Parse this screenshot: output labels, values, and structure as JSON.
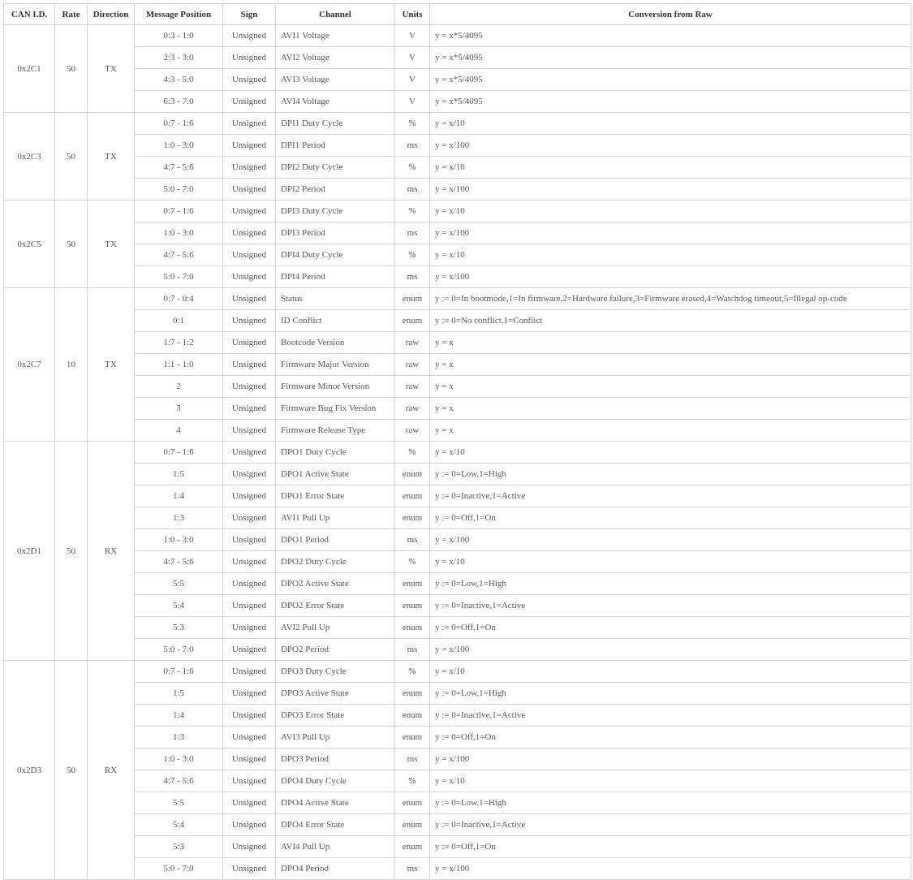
{
  "headers": [
    "CAN I.D.",
    "Rate",
    "Direction",
    "Message Position",
    "Sign",
    "Channel",
    "Units",
    "Conversion from Raw"
  ],
  "groups": [
    {
      "can_id": "0x2C1",
      "rate": "50",
      "direction": "TX",
      "rows": [
        {
          "position": "0:3 - 1:0",
          "sign": "Unsigned",
          "channel": "AVI1 Voltage",
          "units": "V",
          "conversion": "y = x*5/4095"
        },
        {
          "position": "2:3 - 3:0",
          "sign": "Unsigned",
          "channel": "AVI2 Voltage",
          "units": "V",
          "conversion": "y = x*5/4095"
        },
        {
          "position": "4:3 - 5:0",
          "sign": "Unsigned",
          "channel": "AVI3 Voltage",
          "units": "V",
          "conversion": "y = x*5/4095"
        },
        {
          "position": "6:3 - 7:0",
          "sign": "Unsigned",
          "channel": "AVI4 Voltage",
          "units": "V",
          "conversion": "y = x*5/4095"
        }
      ]
    },
    {
      "can_id": "0x2C3",
      "rate": "50",
      "direction": "TX",
      "rows": [
        {
          "position": "0:7 - 1:6",
          "sign": "Unsigned",
          "channel": "DPI1 Duty Cycle",
          "units": "%",
          "conversion": "y = x/10"
        },
        {
          "position": "1:0 - 3:0",
          "sign": "Unsigned",
          "channel": "DPI1 Period",
          "units": "ms",
          "conversion": "y = x/100"
        },
        {
          "position": "4:7 - 5:6",
          "sign": "Unsigned",
          "channel": "DPI2 Duty Cycle",
          "units": "%",
          "conversion": "y = x/10"
        },
        {
          "position": "5:0 - 7:0",
          "sign": "Unsigned",
          "channel": "DPI2 Period",
          "units": "ms",
          "conversion": "y = x/100"
        }
      ]
    },
    {
      "can_id": "0x2C5",
      "rate": "50",
      "direction": "TX",
      "rows": [
        {
          "position": "0:7 - 1:6",
          "sign": "Unsigned",
          "channel": "DPI3 Duty Cycle",
          "units": "%",
          "conversion": "y = x/10"
        },
        {
          "position": "1:0 - 3:0",
          "sign": "Unsigned",
          "channel": "DPI3 Period",
          "units": "ms",
          "conversion": "y = x/100"
        },
        {
          "position": "4:7 - 5:6",
          "sign": "Unsigned",
          "channel": "DPI4 Duty Cycle",
          "units": "%",
          "conversion": "y = x/10"
        },
        {
          "position": "5:0 - 7:0",
          "sign": "Unsigned",
          "channel": "DPI4 Period",
          "units": "ms",
          "conversion": "y = x/100"
        }
      ]
    },
    {
      "can_id": "0x2C7",
      "rate": "10",
      "direction": "TX",
      "rows": [
        {
          "position": "0:7 - 0:4",
          "sign": "Unsigned",
          "channel": "Status",
          "units": "enum",
          "conversion": "y := 0=In bootmode,1=In firmware,2=Hardware failure,3=Firmware erased,4=Watchdog timeout,5=Illegal op-code"
        },
        {
          "position": "0:1",
          "sign": "Unsigned",
          "channel": "ID Conflict",
          "units": "enum",
          "conversion": "y := 0=No conflict,1=Conflict"
        },
        {
          "position": "1:7 - 1:2",
          "sign": "Unsigned",
          "channel": "Bootcode Version",
          "units": "raw",
          "conversion": "y = x"
        },
        {
          "position": "1:1 - 1:0",
          "sign": "Unsigned",
          "channel": "Firmware Major Version",
          "units": "raw",
          "conversion": "y = x"
        },
        {
          "position": "2",
          "sign": "Unsigned",
          "channel": "Firmware Minor Version",
          "units": "raw",
          "conversion": "y = x"
        },
        {
          "position": "3",
          "sign": "Unsigned",
          "channel": "Firmware Bug Fix Version",
          "units": "raw",
          "conversion": "y = x"
        },
        {
          "position": "4",
          "sign": "Unsigned",
          "channel": "Firmware Release Type",
          "units": "raw",
          "conversion": "y = x"
        }
      ]
    },
    {
      "can_id": "0x2D1",
      "rate": "50",
      "direction": "RX",
      "rows": [
        {
          "position": "0:7 - 1:6",
          "sign": "Unsigned",
          "channel": "DPO1 Duty Cycle",
          "units": "%",
          "conversion": "y = x/10"
        },
        {
          "position": "1:5",
          "sign": "Unsigned",
          "channel": "DPO1 Active State",
          "units": "enum",
          "conversion": "y := 0=Low,1=High"
        },
        {
          "position": "1:4",
          "sign": "Unsigned",
          "channel": "DPO1 Error State",
          "units": "enum",
          "conversion": "y := 0=Inactive,1=Active"
        },
        {
          "position": "1:3",
          "sign": "Unsigned",
          "channel": "AVI1 Pull Up",
          "units": "enum",
          "conversion": "y := 0=Off,1=On"
        },
        {
          "position": "1:0 - 3:0",
          "sign": "Unsigned",
          "channel": "DPO1 Period",
          "units": "ms",
          "conversion": "y = x/100"
        },
        {
          "position": "4:7 - 5:6",
          "sign": "Unsigned",
          "channel": "DPO2 Duty Cycle",
          "units": "%",
          "conversion": "y = x/10"
        },
        {
          "position": "5:5",
          "sign": "Unsigned",
          "channel": "DPO2 Active State",
          "units": "enum",
          "conversion": "y := 0=Low,1=High"
        },
        {
          "position": "5:4",
          "sign": "Unsigned",
          "channel": "DPO2 Error State",
          "units": "enum",
          "conversion": "y := 0=Inactive,1=Active"
        },
        {
          "position": "5:3",
          "sign": "Unsigned",
          "channel": "AVI2 Pull Up",
          "units": "enum",
          "conversion": "y := 0=Off,1=On"
        },
        {
          "position": "5:0 - 7:0",
          "sign": "Unsigned",
          "channel": "DPO2 Period",
          "units": "ms",
          "conversion": "y = x/100"
        }
      ]
    },
    {
      "can_id": "0x2D3",
      "rate": "50",
      "direction": "RX",
      "rows": [
        {
          "position": "0:7 - 1:6",
          "sign": "Unsigned",
          "channel": "DPO3 Duty Cycle",
          "units": "%",
          "conversion": "y = x/10"
        },
        {
          "position": "1:5",
          "sign": "Unsigned",
          "channel": "DPO3 Active State",
          "units": "enum",
          "conversion": "y := 0=Low,1=High"
        },
        {
          "position": "1:4",
          "sign": "Unsigned",
          "channel": "DPO3 Error State",
          "units": "enum",
          "conversion": "y := 0=Inactive,1=Active"
        },
        {
          "position": "1:3",
          "sign": "Unsigned",
          "channel": "AVI3 Pull Up",
          "units": "enum",
          "conversion": "y := 0=Off,1=On"
        },
        {
          "position": "1:0 - 3:0",
          "sign": "Unsigned",
          "channel": "DPO3 Period",
          "units": "ms",
          "conversion": "y = x/100"
        },
        {
          "position": "4:7 - 5:6",
          "sign": "Unsigned",
          "channel": "DPO4 Duty Cycle",
          "units": "%",
          "conversion": "y = x/10"
        },
        {
          "position": "5:5",
          "sign": "Unsigned",
          "channel": "DPO4 Active State",
          "units": "enum",
          "conversion": "y := 0=Low,1=High"
        },
        {
          "position": "5:4",
          "sign": "Unsigned",
          "channel": "DPO4 Error State",
          "units": "enum",
          "conversion": "y := 0=Inactive,1=Active"
        },
        {
          "position": "5:3",
          "sign": "Unsigned",
          "channel": "AVI4 Pull Up",
          "units": "enum",
          "conversion": "y := 0=Off,1=On"
        },
        {
          "position": "5:0 - 7:0",
          "sign": "Unsigned",
          "channel": "DPO4 Period",
          "units": "ms",
          "conversion": "y = x/100"
        }
      ]
    }
  ]
}
